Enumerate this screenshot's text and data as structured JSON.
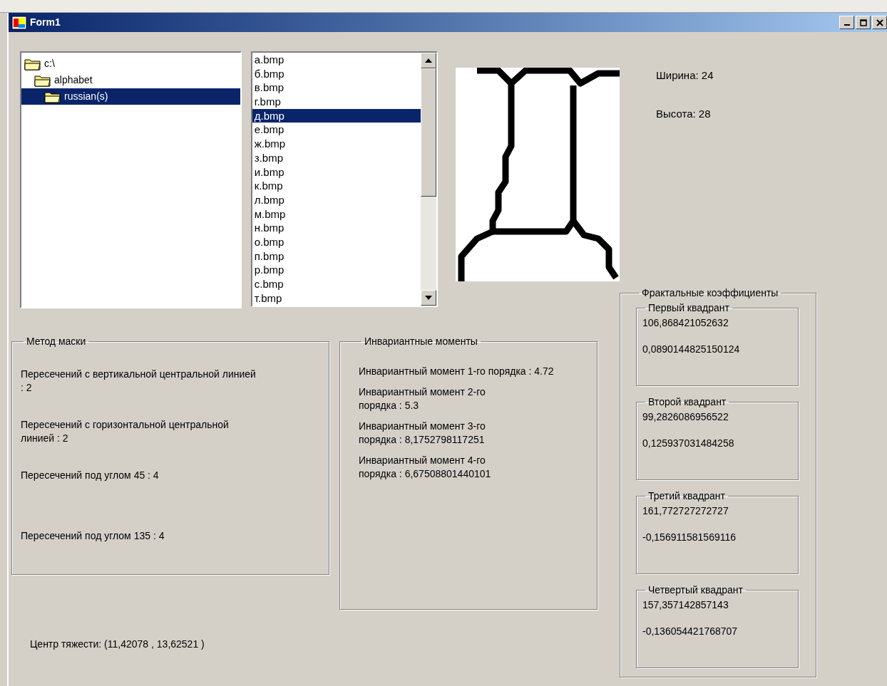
{
  "window": {
    "title": "Form1"
  },
  "tree": [
    {
      "label": "c:\\",
      "selected": false,
      "children": [
        {
          "label": "alphabet",
          "selected": false,
          "children": [
            {
              "label": "russian(s)",
              "selected": true
            }
          ]
        }
      ]
    }
  ],
  "files": [
    {
      "label": "а.bmp",
      "selected": false
    },
    {
      "label": "б.bmp",
      "selected": false
    },
    {
      "label": "в.bmp",
      "selected": false
    },
    {
      "label": "г.bmp",
      "selected": false
    },
    {
      "label": "д.bmp",
      "selected": true
    },
    {
      "label": "е.bmp",
      "selected": false
    },
    {
      "label": "ж.bmp",
      "selected": false
    },
    {
      "label": "з.bmp",
      "selected": false
    },
    {
      "label": "и.bmp",
      "selected": false
    },
    {
      "label": "к.bmp",
      "selected": false
    },
    {
      "label": "л.bmp",
      "selected": false
    },
    {
      "label": "м.bmp",
      "selected": false
    },
    {
      "label": "н.bmp",
      "selected": false
    },
    {
      "label": "о.bmp",
      "selected": false
    },
    {
      "label": "п.bmp",
      "selected": false
    },
    {
      "label": "р.bmp",
      "selected": false
    },
    {
      "label": "с.bmp",
      "selected": false
    },
    {
      "label": "т.bmp",
      "selected": false
    }
  ],
  "size": {
    "width": "Ширина: 24",
    "height": "Высота: 28"
  },
  "mask_method": {
    "title": "Метод маски",
    "lines": [
      "Пересечений с вертикальной центральной линией : 2",
      "Пересечений с горизонтальной центральной линией : 2",
      "Пересечений под углом 45 : 4",
      "Пересечений под углом 135 : 4"
    ]
  },
  "invariant_moments": {
    "title": "Инвариантные моменты",
    "lines": [
      "Инвариантный момент 1-го порядка : 4.72",
      "Инвариантный момент 2-го порядка : 5.3",
      "Инвариантный момент 3-го порядка : 8,1752798117251",
      "Инвариантный момент 4-го порядка : 6,67508801440101"
    ]
  },
  "center_of_gravity": "Центр тяжести: (11,42078 , 13,62521 )",
  "fractal": {
    "title": "Фрактальные коэффициенты",
    "quadrants": [
      {
        "title": "Первый квадрант",
        "values": [
          "106,868421052632",
          "0,0890144825150124"
        ]
      },
      {
        "title": "Второй квадрант",
        "values": [
          "99,2826086956522",
          "0,125937031484258"
        ]
      },
      {
        "title": "Третий квадрант",
        "values": [
          "161,772727272727",
          "-0,156911581569116"
        ]
      },
      {
        "title": "Четвертый квадрант",
        "values": [
          "157,357142857143",
          "-0,136054421768707"
        ]
      }
    ]
  }
}
